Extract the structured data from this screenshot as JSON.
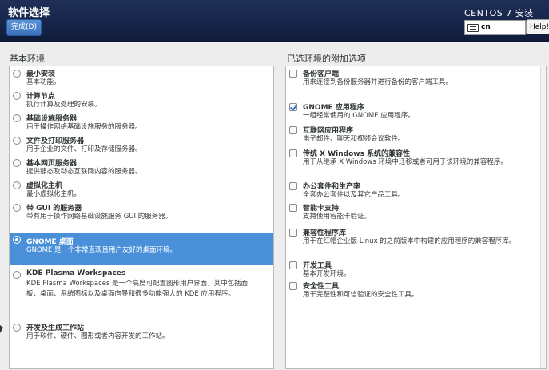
{
  "header": {
    "title": "软件选择",
    "done_button": "完成(D)",
    "product": "CENTOS 7 安装",
    "keyboard_layout": "cn",
    "help_button": "Help!"
  },
  "base_env": {
    "title": "基本环境",
    "items": [
      {
        "name": "最小安装",
        "desc": "基本功能。",
        "selected": false
      },
      {
        "name": "计算节点",
        "desc": "执行计算及处理的安装。",
        "selected": false
      },
      {
        "name": "基础设施服务器",
        "desc": "用于操作网络基础设施服务的服务器。",
        "selected": false
      },
      {
        "name": "文件及打印服务器",
        "desc": "用于企业的文件、打印及存储服务器。",
        "selected": false
      },
      {
        "name": "基本网页服务器",
        "desc": "提供静态及动态互联网内容的服务器。",
        "selected": false
      },
      {
        "name": "虚拟化主机",
        "desc": "最小虚拟化主机。",
        "selected": false
      },
      {
        "name": "带 GUI 的服务器",
        "desc": "带有用于操作网络基础设施服务 GUI 的服务器。",
        "selected": false
      },
      {
        "name": "GNOME 桌面",
        "desc": "GNOME 是一个非常直观且用户友好的桌面环境。",
        "selected": true
      },
      {
        "name": "KDE Plasma Workspaces",
        "desc": "KDE Plasma Workspaces 是一个高度可配置图形用户界面，其中包括面",
        "desc2": "板、桌面、系统图标以及桌面向导和很多功能强大的 KDE 应用程序。",
        "selected": false
      },
      {
        "name": "开发及生成工作站",
        "desc": "用于软件、硬件、图形或者内容开发的工作站。",
        "selected": false
      }
    ]
  },
  "addons": {
    "title": "已选环境的附加选项",
    "items": [
      {
        "name": "备份客户端",
        "desc": "用来连接到备份服务器并进行备份的客户端工具。",
        "checked": false
      },
      {
        "name": "GNOME 应用程序",
        "desc": "一组经常使用的 GNOME 应用程序。",
        "checked": true
      },
      {
        "name": "互联网应用程序",
        "desc": "电子邮件、聊天和视频会议软件。",
        "checked": false
      },
      {
        "name": "传统 X Windows 系统的兼容性",
        "desc": "用于从继承 X Windows 环境中迁移或者可用于该环境的兼容程序。",
        "checked": false
      },
      {
        "name": "办公套件和生产率",
        "desc": "全套办公套件以及其它产品工具。",
        "checked": false
      },
      {
        "name": "智能卡支持",
        "desc": "支持使用智能卡验证。",
        "checked": false
      },
      {
        "name": "兼容性程序库",
        "desc": "用于在红帽企业版 Linux 的之前版本中构建的应用程序的兼容程序库。",
        "checked": false
      },
      {
        "name": "开发工具",
        "desc": "基本开发环境。",
        "checked": false
      },
      {
        "name": "安全性工具",
        "desc": "用于完整性和可信验证的安全性工具。",
        "checked": false
      }
    ]
  }
}
